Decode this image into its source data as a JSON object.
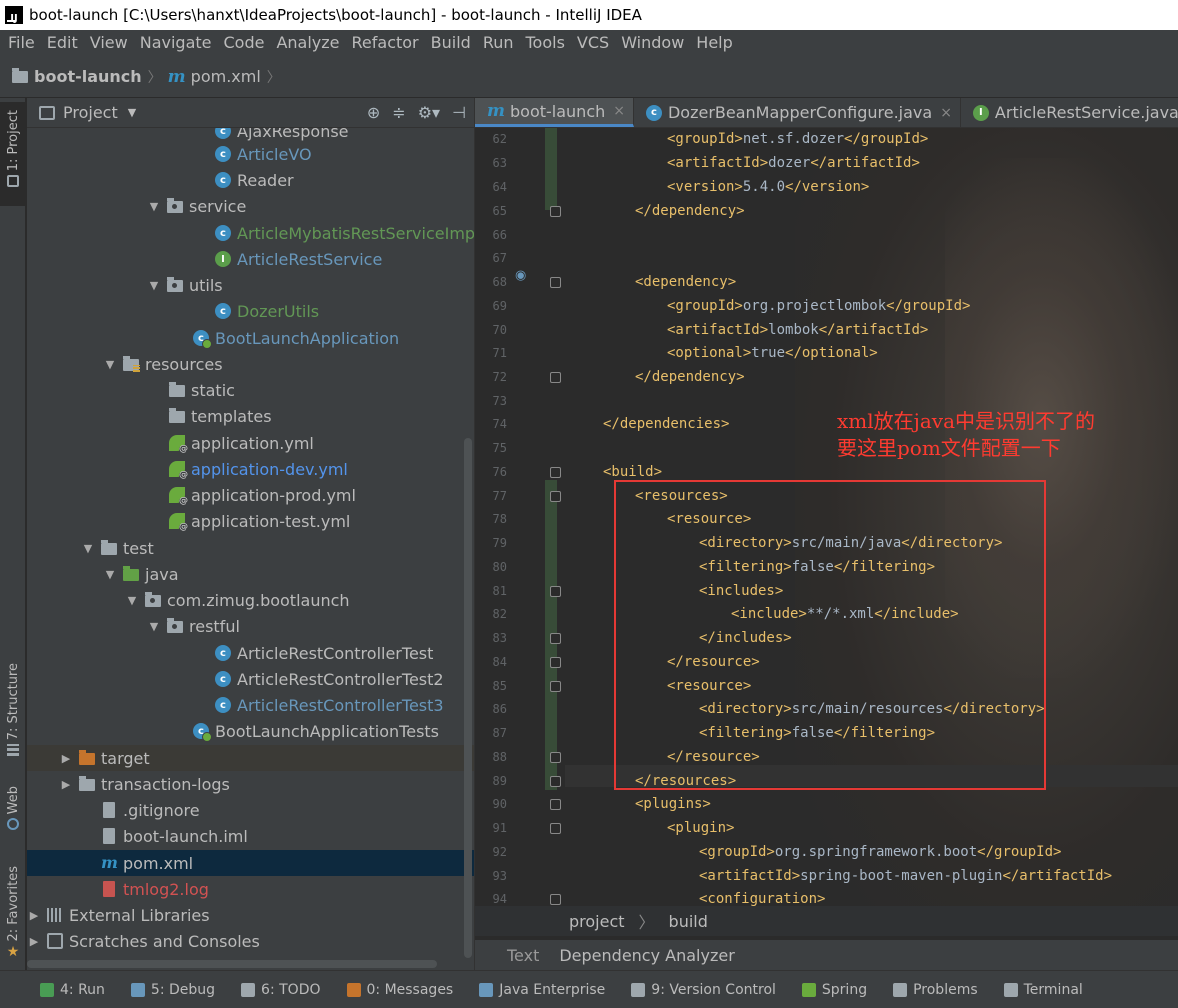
{
  "window": {
    "title": "boot-launch [C:\\Users\\hanxt\\IdeaProjects\\boot-launch] - boot-launch - IntelliJ IDEA"
  },
  "menu": [
    "File",
    "Edit",
    "View",
    "Navigate",
    "Code",
    "Analyze",
    "Refactor",
    "Build",
    "Run",
    "Tools",
    "VCS",
    "Window",
    "Help"
  ],
  "nav": {
    "project": "boot-launch",
    "file": "pom.xml"
  },
  "left_strip": {
    "project": "1: Project",
    "structure": "7: Structure",
    "web": "Web",
    "favorites": "2: Favorites"
  },
  "project_panel": {
    "title": "Project",
    "tree": [
      {
        "label": "AjaxResponse",
        "icon": "class-icon",
        "color": "default"
      },
      {
        "label": "ArticleVO",
        "icon": "class-icon",
        "color": "blue"
      },
      {
        "label": "Reader",
        "icon": "class-icon",
        "color": "default"
      },
      {
        "label": "service",
        "icon": "package-icon",
        "color": "default"
      },
      {
        "label": "ArticleMybatisRestServiceImpl",
        "icon": "class-icon",
        "color": "green"
      },
      {
        "label": "ArticleRestService",
        "icon": "interface-icon",
        "color": "blue"
      },
      {
        "label": "utils",
        "icon": "package-icon",
        "color": "default"
      },
      {
        "label": "DozerUtils",
        "icon": "class-icon",
        "color": "green"
      },
      {
        "label": "BootLaunchApplication",
        "icon": "spring-app-icon",
        "color": "blue"
      },
      {
        "label": "resources",
        "icon": "resources-folder-icon",
        "color": "default"
      },
      {
        "label": "static",
        "icon": "folder-icon",
        "color": "default"
      },
      {
        "label": "templates",
        "icon": "folder-icon",
        "color": "default"
      },
      {
        "label": "application.yml",
        "icon": "spring-config-icon",
        "color": "default"
      },
      {
        "label": "application-dev.yml",
        "icon": "spring-config-icon",
        "color": "lightblue"
      },
      {
        "label": "application-prod.yml",
        "icon": "spring-config-icon",
        "color": "default"
      },
      {
        "label": "application-test.yml",
        "icon": "spring-config-icon",
        "color": "default"
      },
      {
        "label": "test",
        "icon": "folder-icon",
        "color": "default"
      },
      {
        "label": "java",
        "icon": "test-source-folder-icon",
        "color": "default"
      },
      {
        "label": "com.zimug.bootlaunch",
        "icon": "package-icon",
        "color": "default"
      },
      {
        "label": "restful",
        "icon": "package-icon",
        "color": "default"
      },
      {
        "label": "ArticleRestControllerTest",
        "icon": "class-icon",
        "color": "default"
      },
      {
        "label": "ArticleRestControllerTest2",
        "icon": "class-icon",
        "color": "default"
      },
      {
        "label": "ArticleRestControllerTest3",
        "icon": "class-icon",
        "color": "blue"
      },
      {
        "label": "BootLaunchApplicationTests",
        "icon": "spring-app-icon",
        "color": "default"
      },
      {
        "label": "target",
        "icon": "excluded-folder-icon",
        "color": "default"
      },
      {
        "label": "transaction-logs",
        "icon": "folder-icon",
        "color": "default"
      },
      {
        "label": ".gitignore",
        "icon": "file-icon",
        "color": "default"
      },
      {
        "label": "boot-launch.iml",
        "icon": "file-icon",
        "color": "default"
      },
      {
        "label": "pom.xml",
        "icon": "maven-icon",
        "color": "default"
      },
      {
        "label": "tmlog2.log",
        "icon": "log-file-icon",
        "color": "red"
      },
      {
        "label": "External Libraries",
        "icon": "library-icon",
        "color": "default"
      },
      {
        "label": "Scratches and Consoles",
        "icon": "scratch-icon",
        "color": "default"
      }
    ]
  },
  "editor": {
    "tabs": [
      {
        "label": "boot-launch",
        "icon": "maven-icon",
        "active": true
      },
      {
        "label": "DozerBeanMapperConfigure.java",
        "icon": "class-icon",
        "active": false
      },
      {
        "label": "ArticleRestService.java",
        "icon": "interface-icon",
        "active": false
      }
    ],
    "lines": [
      {
        "n": "62",
        "indent": 2,
        "parts": [
          [
            "t",
            "<groupId>"
          ],
          [
            "x",
            "net.sf.dozer"
          ],
          [
            "t",
            "</groupId>"
          ]
        ]
      },
      {
        "n": "63",
        "indent": 2,
        "parts": [
          [
            "t",
            "<artifactId>"
          ],
          [
            "x",
            "dozer"
          ],
          [
            "t",
            "</artifactId>"
          ]
        ]
      },
      {
        "n": "64",
        "indent": 2,
        "parts": [
          [
            "t",
            "<version>"
          ],
          [
            "x",
            "5.4.0"
          ],
          [
            "t",
            "</version>"
          ]
        ]
      },
      {
        "n": "65",
        "indent": 1,
        "parts": [
          [
            "t",
            "</dependency>"
          ]
        ]
      },
      {
        "n": "66",
        "indent": 0,
        "parts": []
      },
      {
        "n": "67",
        "indent": 0,
        "parts": []
      },
      {
        "n": "68",
        "indent": 1,
        "parts": [
          [
            "t",
            "<dependency>"
          ]
        ]
      },
      {
        "n": "69",
        "indent": 2,
        "parts": [
          [
            "t",
            "<groupId>"
          ],
          [
            "x",
            "org.projectlombok"
          ],
          [
            "t",
            "</groupId>"
          ]
        ]
      },
      {
        "n": "70",
        "indent": 2,
        "parts": [
          [
            "t",
            "<artifactId>"
          ],
          [
            "x",
            "lombok"
          ],
          [
            "t",
            "</artifactId>"
          ]
        ]
      },
      {
        "n": "71",
        "indent": 2,
        "parts": [
          [
            "t",
            "<optional>"
          ],
          [
            "x",
            "true"
          ],
          [
            "t",
            "</optional>"
          ]
        ]
      },
      {
        "n": "72",
        "indent": 1,
        "parts": [
          [
            "t",
            "</dependency>"
          ]
        ]
      },
      {
        "n": "73",
        "indent": 0,
        "parts": []
      },
      {
        "n": "74",
        "indent": 0,
        "parts": [
          [
            "t",
            "</dependencies>"
          ]
        ]
      },
      {
        "n": "75",
        "indent": 0,
        "parts": []
      },
      {
        "n": "76",
        "indent": 0,
        "parts": [
          [
            "t",
            "<build>"
          ]
        ]
      },
      {
        "n": "77",
        "indent": 1,
        "parts": [
          [
            "t",
            "<resources>"
          ]
        ]
      },
      {
        "n": "78",
        "indent": 2,
        "parts": [
          [
            "t",
            "<resource>"
          ]
        ]
      },
      {
        "n": "79",
        "indent": 3,
        "parts": [
          [
            "t",
            "<directory>"
          ],
          [
            "x",
            "src/main/java"
          ],
          [
            "t",
            "</directory>"
          ]
        ]
      },
      {
        "n": "80",
        "indent": 3,
        "parts": [
          [
            "t",
            "<filtering>"
          ],
          [
            "x",
            "false"
          ],
          [
            "t",
            "</filtering>"
          ]
        ]
      },
      {
        "n": "81",
        "indent": 3,
        "parts": [
          [
            "t",
            "<includes>"
          ]
        ]
      },
      {
        "n": "82",
        "indent": 4,
        "parts": [
          [
            "t",
            "<include>"
          ],
          [
            "x",
            "**/*.xml"
          ],
          [
            "t",
            "</include>"
          ]
        ]
      },
      {
        "n": "83",
        "indent": 3,
        "parts": [
          [
            "t",
            "</includes>"
          ]
        ]
      },
      {
        "n": "84",
        "indent": 2,
        "parts": [
          [
            "t",
            "</resource>"
          ]
        ]
      },
      {
        "n": "85",
        "indent": 2,
        "parts": [
          [
            "t",
            "<resource>"
          ]
        ]
      },
      {
        "n": "86",
        "indent": 3,
        "parts": [
          [
            "t",
            "<directory>"
          ],
          [
            "x",
            "src/main/resources"
          ],
          [
            "t",
            "</directory>"
          ]
        ]
      },
      {
        "n": "87",
        "indent": 3,
        "parts": [
          [
            "t",
            "<filtering>"
          ],
          [
            "x",
            "false"
          ],
          [
            "t",
            "</filtering>"
          ]
        ]
      },
      {
        "n": "88",
        "indent": 2,
        "parts": [
          [
            "t",
            "</resource>"
          ]
        ]
      },
      {
        "n": "89",
        "indent": 1,
        "parts": [
          [
            "t",
            "</resources>"
          ]
        ]
      },
      {
        "n": "90",
        "indent": 1,
        "parts": [
          [
            "t",
            "<plugins>"
          ]
        ]
      },
      {
        "n": "91",
        "indent": 2,
        "parts": [
          [
            "t",
            "<plugin>"
          ]
        ]
      },
      {
        "n": "92",
        "indent": 3,
        "parts": [
          [
            "t",
            "<groupId>"
          ],
          [
            "x",
            "org.springframework.boot"
          ],
          [
            "t",
            "</groupId>"
          ]
        ]
      },
      {
        "n": "93",
        "indent": 3,
        "parts": [
          [
            "t",
            "<artifactId>"
          ],
          [
            "x",
            "spring-boot-maven-plugin"
          ],
          [
            "t",
            "</artifactId>"
          ]
        ]
      },
      {
        "n": "94",
        "indent": 3,
        "parts": [
          [
            "t",
            "<configuration>"
          ]
        ]
      }
    ],
    "annotation_line1": "xml放在java中是识别不了的",
    "annotation_line2": "要这里pom文件配置一下",
    "breadcrumb": [
      "project",
      "build"
    ],
    "bottom_tabs": [
      "Text",
      "Dependency Analyzer"
    ]
  },
  "statusbar": [
    {
      "label": "4: Run",
      "icon": "run-icon"
    },
    {
      "label": "5: Debug",
      "icon": "debug-icon"
    },
    {
      "label": "6: TODO",
      "icon": "todo-icon"
    },
    {
      "label": "0: Messages",
      "icon": "messages-icon"
    },
    {
      "label": "Java Enterprise",
      "icon": "java-enterprise-icon"
    },
    {
      "label": "9: Version Control",
      "icon": "vcs-icon"
    },
    {
      "label": "Spring",
      "icon": "spring-icon"
    },
    {
      "label": "Problems",
      "icon": "problems-icon"
    },
    {
      "label": "Terminal",
      "icon": "terminal-icon"
    }
  ],
  "colors": {
    "tag": "#e8bf6a",
    "text": "#a9b7c6",
    "annotation": "#ff3b30",
    "selection": "#0d293e"
  }
}
